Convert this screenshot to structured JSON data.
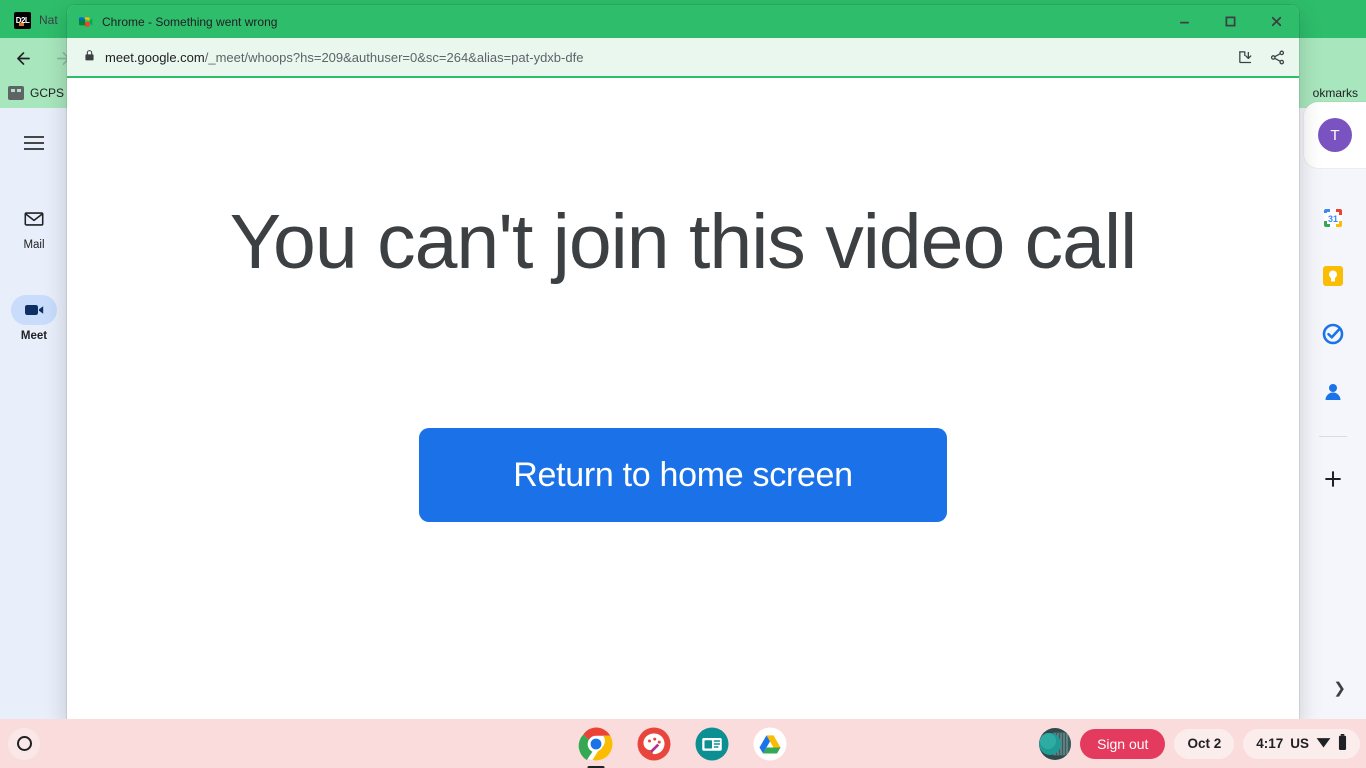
{
  "background_browser": {
    "tab": {
      "title": "Nat",
      "favicon": "d2l-favicon"
    },
    "nav": {
      "back": "back-arrow-icon",
      "forward": "forward-arrow-icon"
    },
    "bookmarks": {
      "folder_label": "GCPS",
      "all_bookmarks_label": "okmarks"
    }
  },
  "left_rail": {
    "menu_icon": "hamburger-menu-icon",
    "items": [
      {
        "label": "Mail",
        "icon": "mail-envelope-icon",
        "selected": false
      },
      {
        "label": "Meet",
        "icon": "video-camera-icon",
        "selected": true
      }
    ]
  },
  "right_panel": {
    "avatar_initial": "T",
    "avatar_color": "#7b53c1",
    "items": [
      {
        "icon": "google-calendar-icon",
        "label": "Calendar",
        "day": "31"
      },
      {
        "icon": "google-keep-icon",
        "label": "Keep"
      },
      {
        "icon": "google-tasks-icon",
        "label": "Tasks"
      },
      {
        "icon": "google-contacts-icon",
        "label": "Contacts"
      },
      {
        "icon": "plus-icon",
        "label": "Get add-ons"
      }
    ],
    "expand_icon": "chevron-right-icon"
  },
  "chrome_window": {
    "title": "Chrome - Something went wrong",
    "favicon": "google-meet-icon",
    "controls": {
      "minimize": "minimize-icon",
      "maximize": "maximize-icon",
      "close": "close-icon"
    },
    "omnibox": {
      "lock": "lock-icon",
      "url_domain": "meet.google.com",
      "url_path": "/_meet/whoops?hs=209&authuser=0&sc=264&alias=pat-ydxb-dfe",
      "install_icon": "install-app-icon",
      "share_icon": "share-icon"
    }
  },
  "page": {
    "heading": "You can't join this video call",
    "primary_button": "Return to home screen",
    "button_color": "#1b72e8",
    "heading_color": "#3c4043"
  },
  "shelf": {
    "launcher_icon": "launcher-circle-icon",
    "apps": [
      {
        "name": "chrome-app",
        "icon": "google-chrome-icon",
        "active": true
      },
      {
        "name": "art-app",
        "icon": "paint-palette-icon",
        "active": false
      },
      {
        "name": "news-app",
        "icon": "news-card-icon",
        "active": false
      },
      {
        "name": "drive-app",
        "icon": "google-drive-icon",
        "active": false
      }
    ],
    "avatar": "user-avatar-thumbnail",
    "signout_label": "Sign out",
    "signout_color": "#e33a5e",
    "date": "Oct 2",
    "time": "4:17",
    "locale": "US",
    "wifi_icon": "wifi-icon",
    "battery_icon": "battery-icon"
  }
}
